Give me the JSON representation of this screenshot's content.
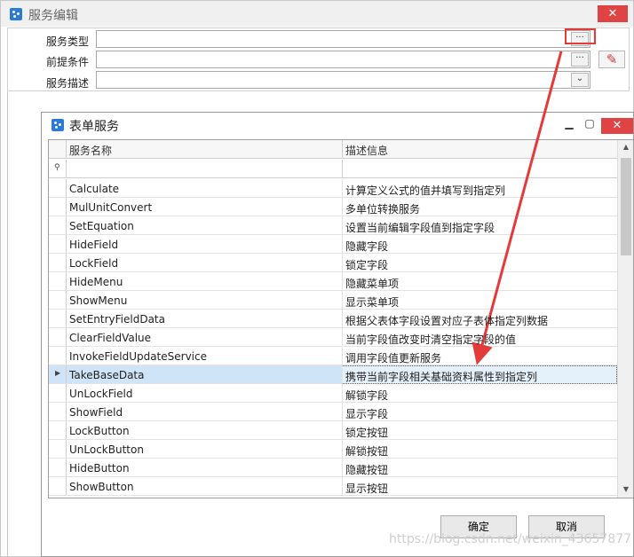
{
  "outer": {
    "title": "服务编辑",
    "close_glyph": "✕",
    "fields": [
      {
        "label": "服务类型",
        "value": "",
        "button": "···"
      },
      {
        "label": "前提条件",
        "value": "",
        "button": "···"
      },
      {
        "label": "服务描述",
        "value": "",
        "button": "⌄"
      }
    ],
    "clear_icon": "eraser-icon"
  },
  "dialog": {
    "title": "表单服务",
    "min_glyph": "▁",
    "max_glyph": "▢",
    "close_glyph": "✕",
    "columns": [
      "服务名称",
      "描述信息"
    ],
    "rows": [
      {
        "name": "Calculate",
        "desc": "计算定义公式的值并填写到指定列"
      },
      {
        "name": "MulUnitConvert",
        "desc": "多单位转换服务"
      },
      {
        "name": "SetEquation",
        "desc": "设置当前编辑字段值到指定字段"
      },
      {
        "name": "HideField",
        "desc": "隐藏字段"
      },
      {
        "name": "LockField",
        "desc": "锁定字段"
      },
      {
        "name": "HideMenu",
        "desc": "隐藏菜单项"
      },
      {
        "name": "ShowMenu",
        "desc": "显示菜单项"
      },
      {
        "name": "SetEntryFieldData",
        "desc": "根据父表体字段设置对应子表体指定列数据"
      },
      {
        "name": "ClearFieldValue",
        "desc": "当前字段值改变时清空指定字段的值"
      },
      {
        "name": "InvokeFieldUpdateService",
        "desc": "调用字段值更新服务"
      },
      {
        "name": "TakeBaseData",
        "desc": "携带当前字段相关基础资料属性到指定列"
      },
      {
        "name": "UnLockField",
        "desc": "解锁字段"
      },
      {
        "name": "ShowField",
        "desc": "显示字段"
      },
      {
        "name": "LockButton",
        "desc": "锁定按钮"
      },
      {
        "name": "UnLockButton",
        "desc": "解锁按钮"
      },
      {
        "name": "HideButton",
        "desc": "隐藏按钮"
      },
      {
        "name": "ShowButton",
        "desc": "显示按钮"
      }
    ],
    "selected_index": 10,
    "ok_label": "确定",
    "cancel_label": "取消"
  },
  "watermark": "https://blog.csdn.net/weixin_43657877",
  "colors": {
    "accent": "#2b7ad9",
    "close": "#e04343",
    "annotation": "#e53a3a",
    "selected_row": "#cfe5f7"
  }
}
